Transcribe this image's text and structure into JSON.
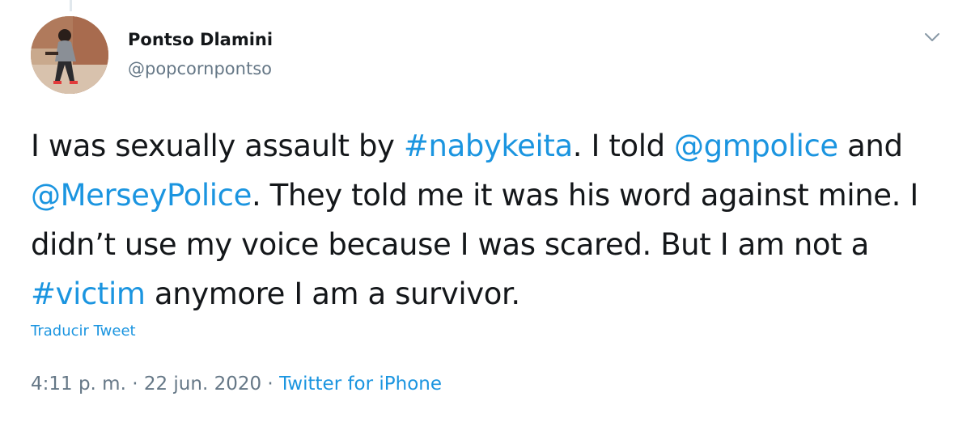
{
  "author": {
    "display_name": "Pontso Dlamini",
    "handle": "@popcornpontso"
  },
  "tweet": {
    "segments": [
      {
        "text": "I was sexually assault by ",
        "kind": "plain"
      },
      {
        "text": "#nabykeita",
        "kind": "hashtag"
      },
      {
        "text": ". I told ",
        "kind": "plain"
      },
      {
        "text": "@gmpolice",
        "kind": "mention"
      },
      {
        "text": " and ",
        "kind": "plain"
      },
      {
        "text": "@MerseyPolice",
        "kind": "mention"
      },
      {
        "text": ". They told me it was his word against mine. I didn’t use my voice because I was scared. But I am not a ",
        "kind": "plain"
      },
      {
        "text": "#victim",
        "kind": "hashtag"
      },
      {
        "text": " anymore I am a survivor.",
        "kind": "plain"
      }
    ],
    "translate_label": "Traducir Tweet"
  },
  "meta": {
    "time": "4:11 p. m.",
    "separator": " · ",
    "date": "22 jun. 2020",
    "source": "Twitter for iPhone"
  },
  "icons": {
    "caret": "chevron-down-icon"
  },
  "colors": {
    "link": "#1b95e0",
    "secondary_text": "#657786",
    "primary_text": "#14171a"
  }
}
